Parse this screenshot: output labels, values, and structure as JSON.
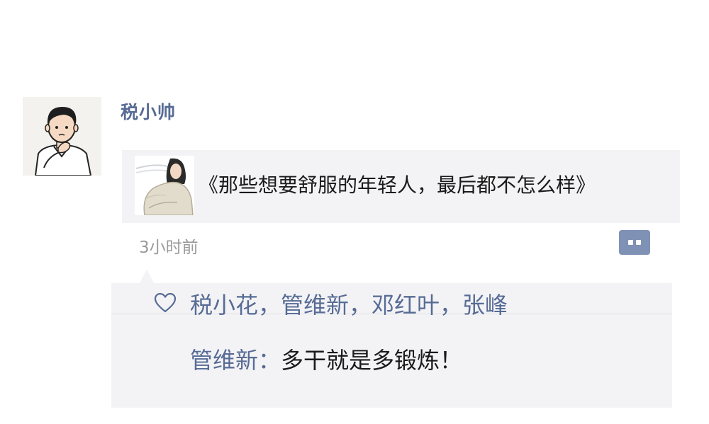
{
  "post": {
    "username": "税小帅",
    "avatar_icon": "cartoon-man-thinking-avatar",
    "shared_link": {
      "thumbnail_icon": "woman-sweater-thumbnail",
      "title": "《那些想要舒服的年轻人，最后都不怎么样》"
    },
    "time": "3小时前",
    "comment_button_icon": "more-dots-icon"
  },
  "interactions": {
    "like_icon": "heart-icon",
    "likes": "税小花，管维新，邓红叶，张峰",
    "comments": [
      {
        "author": "管维新：",
        "text": "多干就是多锻炼！"
      }
    ]
  },
  "colors": {
    "link_blue": "#576b95",
    "card_bg": "#f3f3f5",
    "time_gray": "#9a9a9a",
    "button_bg": "#7f91b5"
  }
}
